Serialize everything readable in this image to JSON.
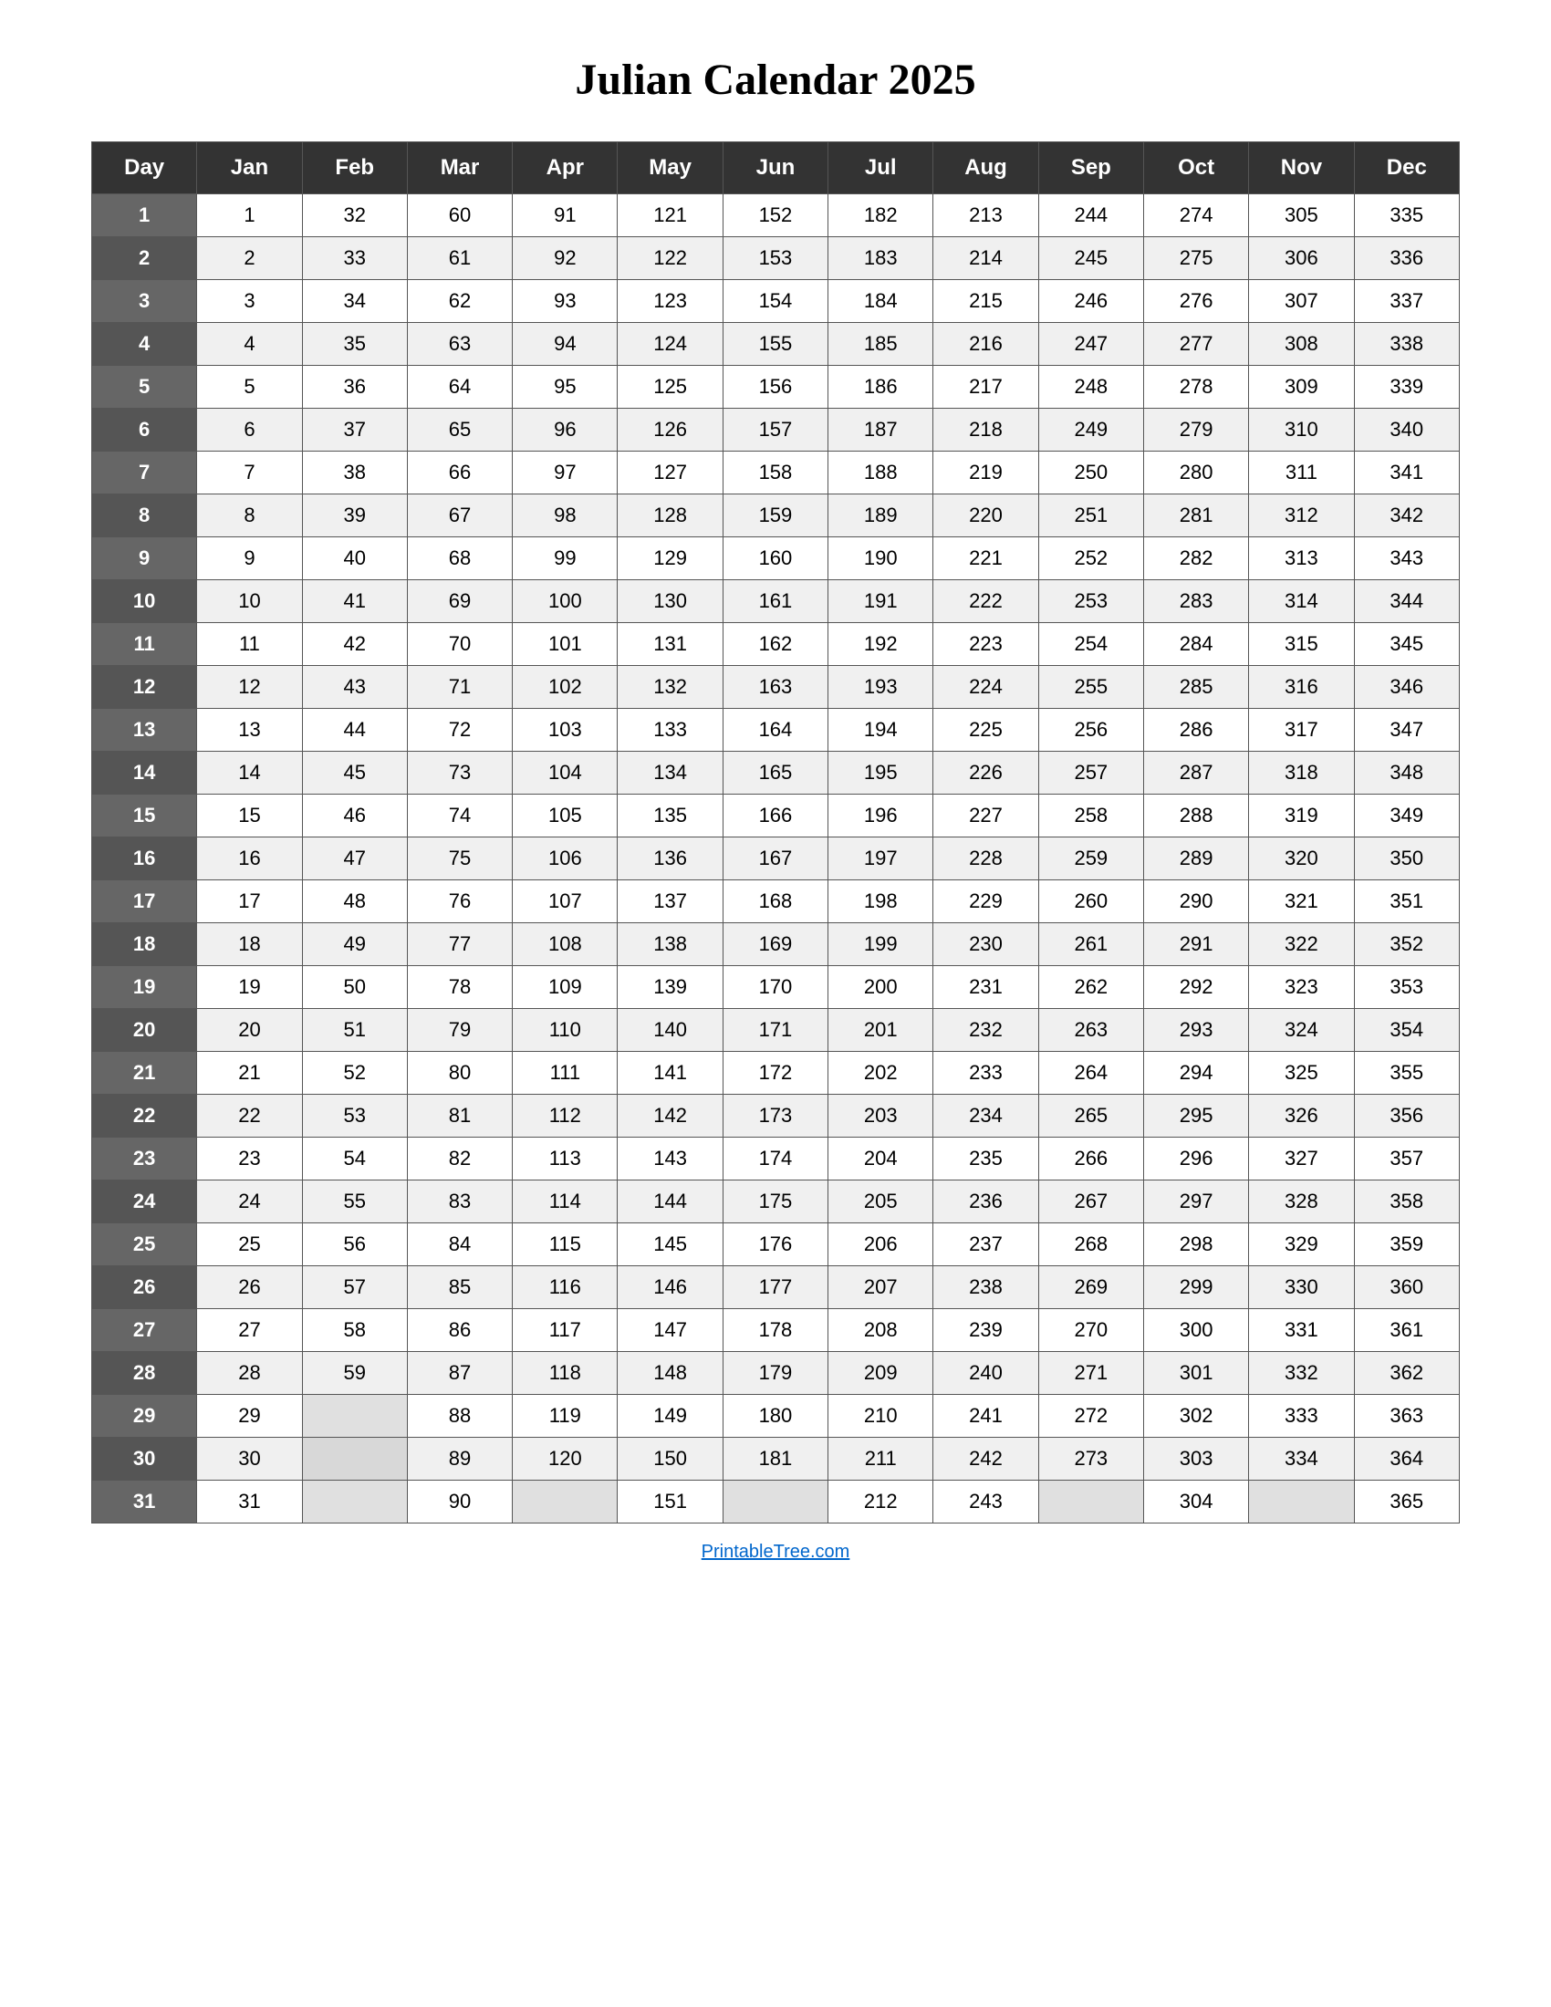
{
  "title": "Julian Calendar 2025",
  "footer": "PrintableTree.com",
  "headers": [
    "Day",
    "Jan",
    "Feb",
    "Mar",
    "Apr",
    "May",
    "Jun",
    "Jul",
    "Aug",
    "Sep",
    "Oct",
    "Nov",
    "Dec"
  ],
  "rows": [
    {
      "day": 1,
      "jan": "1",
      "feb": "32",
      "mar": "60",
      "apr": "91",
      "may": "121",
      "jun": "152",
      "jul": "182",
      "aug": "213",
      "sep": "244",
      "oct": "274",
      "nov": "305",
      "dec": "335"
    },
    {
      "day": 2,
      "jan": "2",
      "feb": "33",
      "mar": "61",
      "apr": "92",
      "may": "122",
      "jun": "153",
      "jul": "183",
      "aug": "214",
      "sep": "245",
      "oct": "275",
      "nov": "306",
      "dec": "336"
    },
    {
      "day": 3,
      "jan": "3",
      "feb": "34",
      "mar": "62",
      "apr": "93",
      "may": "123",
      "jun": "154",
      "jul": "184",
      "aug": "215",
      "sep": "246",
      "oct": "276",
      "nov": "307",
      "dec": "337"
    },
    {
      "day": 4,
      "jan": "4",
      "feb": "35",
      "mar": "63",
      "apr": "94",
      "may": "124",
      "jun": "155",
      "jul": "185",
      "aug": "216",
      "sep": "247",
      "oct": "277",
      "nov": "308",
      "dec": "338"
    },
    {
      "day": 5,
      "jan": "5",
      "feb": "36",
      "mar": "64",
      "apr": "95",
      "may": "125",
      "jun": "156",
      "jul": "186",
      "aug": "217",
      "sep": "248",
      "oct": "278",
      "nov": "309",
      "dec": "339"
    },
    {
      "day": 6,
      "jan": "6",
      "feb": "37",
      "mar": "65",
      "apr": "96",
      "may": "126",
      "jun": "157",
      "jul": "187",
      "aug": "218",
      "sep": "249",
      "oct": "279",
      "nov": "310",
      "dec": "340"
    },
    {
      "day": 7,
      "jan": "7",
      "feb": "38",
      "mar": "66",
      "apr": "97",
      "may": "127",
      "jun": "158",
      "jul": "188",
      "aug": "219",
      "sep": "250",
      "oct": "280",
      "nov": "311",
      "dec": "341"
    },
    {
      "day": 8,
      "jan": "8",
      "feb": "39",
      "mar": "67",
      "apr": "98",
      "may": "128",
      "jun": "159",
      "jul": "189",
      "aug": "220",
      "sep": "251",
      "oct": "281",
      "nov": "312",
      "dec": "342"
    },
    {
      "day": 9,
      "jan": "9",
      "feb": "40",
      "mar": "68",
      "apr": "99",
      "may": "129",
      "jun": "160",
      "jul": "190",
      "aug": "221",
      "sep": "252",
      "oct": "282",
      "nov": "313",
      "dec": "343"
    },
    {
      "day": 10,
      "jan": "10",
      "feb": "41",
      "mar": "69",
      "apr": "100",
      "may": "130",
      "jun": "161",
      "jul": "191",
      "aug": "222",
      "sep": "253",
      "oct": "283",
      "nov": "314",
      "dec": "344"
    },
    {
      "day": 11,
      "jan": "11",
      "feb": "42",
      "mar": "70",
      "apr": "101",
      "may": "131",
      "jun": "162",
      "jul": "192",
      "aug": "223",
      "sep": "254",
      "oct": "284",
      "nov": "315",
      "dec": "345"
    },
    {
      "day": 12,
      "jan": "12",
      "feb": "43",
      "mar": "71",
      "apr": "102",
      "may": "132",
      "jun": "163",
      "jul": "193",
      "aug": "224",
      "sep": "255",
      "oct": "285",
      "nov": "316",
      "dec": "346"
    },
    {
      "day": 13,
      "jan": "13",
      "feb": "44",
      "mar": "72",
      "apr": "103",
      "may": "133",
      "jun": "164",
      "jul": "194",
      "aug": "225",
      "sep": "256",
      "oct": "286",
      "nov": "317",
      "dec": "347"
    },
    {
      "day": 14,
      "jan": "14",
      "feb": "45",
      "mar": "73",
      "apr": "104",
      "may": "134",
      "jun": "165",
      "jul": "195",
      "aug": "226",
      "sep": "257",
      "oct": "287",
      "nov": "318",
      "dec": "348"
    },
    {
      "day": 15,
      "jan": "15",
      "feb": "46",
      "mar": "74",
      "apr": "105",
      "may": "135",
      "jun": "166",
      "jul": "196",
      "aug": "227",
      "sep": "258",
      "oct": "288",
      "nov": "319",
      "dec": "349"
    },
    {
      "day": 16,
      "jan": "16",
      "feb": "47",
      "mar": "75",
      "apr": "106",
      "may": "136",
      "jun": "167",
      "jul": "197",
      "aug": "228",
      "sep": "259",
      "oct": "289",
      "nov": "320",
      "dec": "350"
    },
    {
      "day": 17,
      "jan": "17",
      "feb": "48",
      "mar": "76",
      "apr": "107",
      "may": "137",
      "jun": "168",
      "jul": "198",
      "aug": "229",
      "sep": "260",
      "oct": "290",
      "nov": "321",
      "dec": "351"
    },
    {
      "day": 18,
      "jan": "18",
      "feb": "49",
      "mar": "77",
      "apr": "108",
      "may": "138",
      "jun": "169",
      "jul": "199",
      "aug": "230",
      "sep": "261",
      "oct": "291",
      "nov": "322",
      "dec": "352"
    },
    {
      "day": 19,
      "jan": "19",
      "feb": "50",
      "mar": "78",
      "apr": "109",
      "may": "139",
      "jun": "170",
      "jul": "200",
      "aug": "231",
      "sep": "262",
      "oct": "292",
      "nov": "323",
      "dec": "353"
    },
    {
      "day": 20,
      "jan": "20",
      "feb": "51",
      "mar": "79",
      "apr": "110",
      "may": "140",
      "jun": "171",
      "jul": "201",
      "aug": "232",
      "sep": "263",
      "oct": "293",
      "nov": "324",
      "dec": "354"
    },
    {
      "day": 21,
      "jan": "21",
      "feb": "52",
      "mar": "80",
      "apr": "111",
      "may": "141",
      "jun": "172",
      "jul": "202",
      "aug": "233",
      "sep": "264",
      "oct": "294",
      "nov": "325",
      "dec": "355"
    },
    {
      "day": 22,
      "jan": "22",
      "feb": "53",
      "mar": "81",
      "apr": "112",
      "may": "142",
      "jun": "173",
      "jul": "203",
      "aug": "234",
      "sep": "265",
      "oct": "295",
      "nov": "326",
      "dec": "356"
    },
    {
      "day": 23,
      "jan": "23",
      "feb": "54",
      "mar": "82",
      "apr": "113",
      "may": "143",
      "jun": "174",
      "jul": "204",
      "aug": "235",
      "sep": "266",
      "oct": "296",
      "nov": "327",
      "dec": "357"
    },
    {
      "day": 24,
      "jan": "24",
      "feb": "55",
      "mar": "83",
      "apr": "114",
      "may": "144",
      "jun": "175",
      "jul": "205",
      "aug": "236",
      "sep": "267",
      "oct": "297",
      "nov": "328",
      "dec": "358"
    },
    {
      "day": 25,
      "jan": "25",
      "feb": "56",
      "mar": "84",
      "apr": "115",
      "may": "145",
      "jun": "176",
      "jul": "206",
      "aug": "237",
      "sep": "268",
      "oct": "298",
      "nov": "329",
      "dec": "359"
    },
    {
      "day": 26,
      "jan": "26",
      "feb": "57",
      "mar": "85",
      "apr": "116",
      "may": "146",
      "jun": "177",
      "jul": "207",
      "aug": "238",
      "sep": "269",
      "oct": "299",
      "nov": "330",
      "dec": "360"
    },
    {
      "day": 27,
      "jan": "27",
      "feb": "58",
      "mar": "86",
      "apr": "117",
      "may": "147",
      "jun": "178",
      "jul": "208",
      "aug": "239",
      "sep": "270",
      "oct": "300",
      "nov": "331",
      "dec": "361"
    },
    {
      "day": 28,
      "jan": "28",
      "feb": "59",
      "mar": "87",
      "apr": "118",
      "may": "148",
      "jun": "179",
      "jul": "209",
      "aug": "240",
      "sep": "271",
      "oct": "301",
      "nov": "332",
      "dec": "362"
    },
    {
      "day": 29,
      "jan": "29",
      "feb": "",
      "mar": "88",
      "apr": "119",
      "may": "149",
      "jun": "180",
      "jul": "210",
      "aug": "241",
      "sep": "272",
      "oct": "302",
      "nov": "333",
      "dec": "363"
    },
    {
      "day": 30,
      "jan": "30",
      "feb": "",
      "mar": "89",
      "apr": "120",
      "may": "150",
      "jun": "181",
      "jul": "211",
      "aug": "242",
      "sep": "273",
      "oct": "303",
      "nov": "334",
      "dec": "364"
    },
    {
      "day": 31,
      "jan": "31",
      "feb": "",
      "mar": "90",
      "apr": "",
      "may": "151",
      "jun": "",
      "jul": "212",
      "aug": "243",
      "sep": "",
      "oct": "304",
      "nov": "",
      "dec": "365"
    }
  ]
}
